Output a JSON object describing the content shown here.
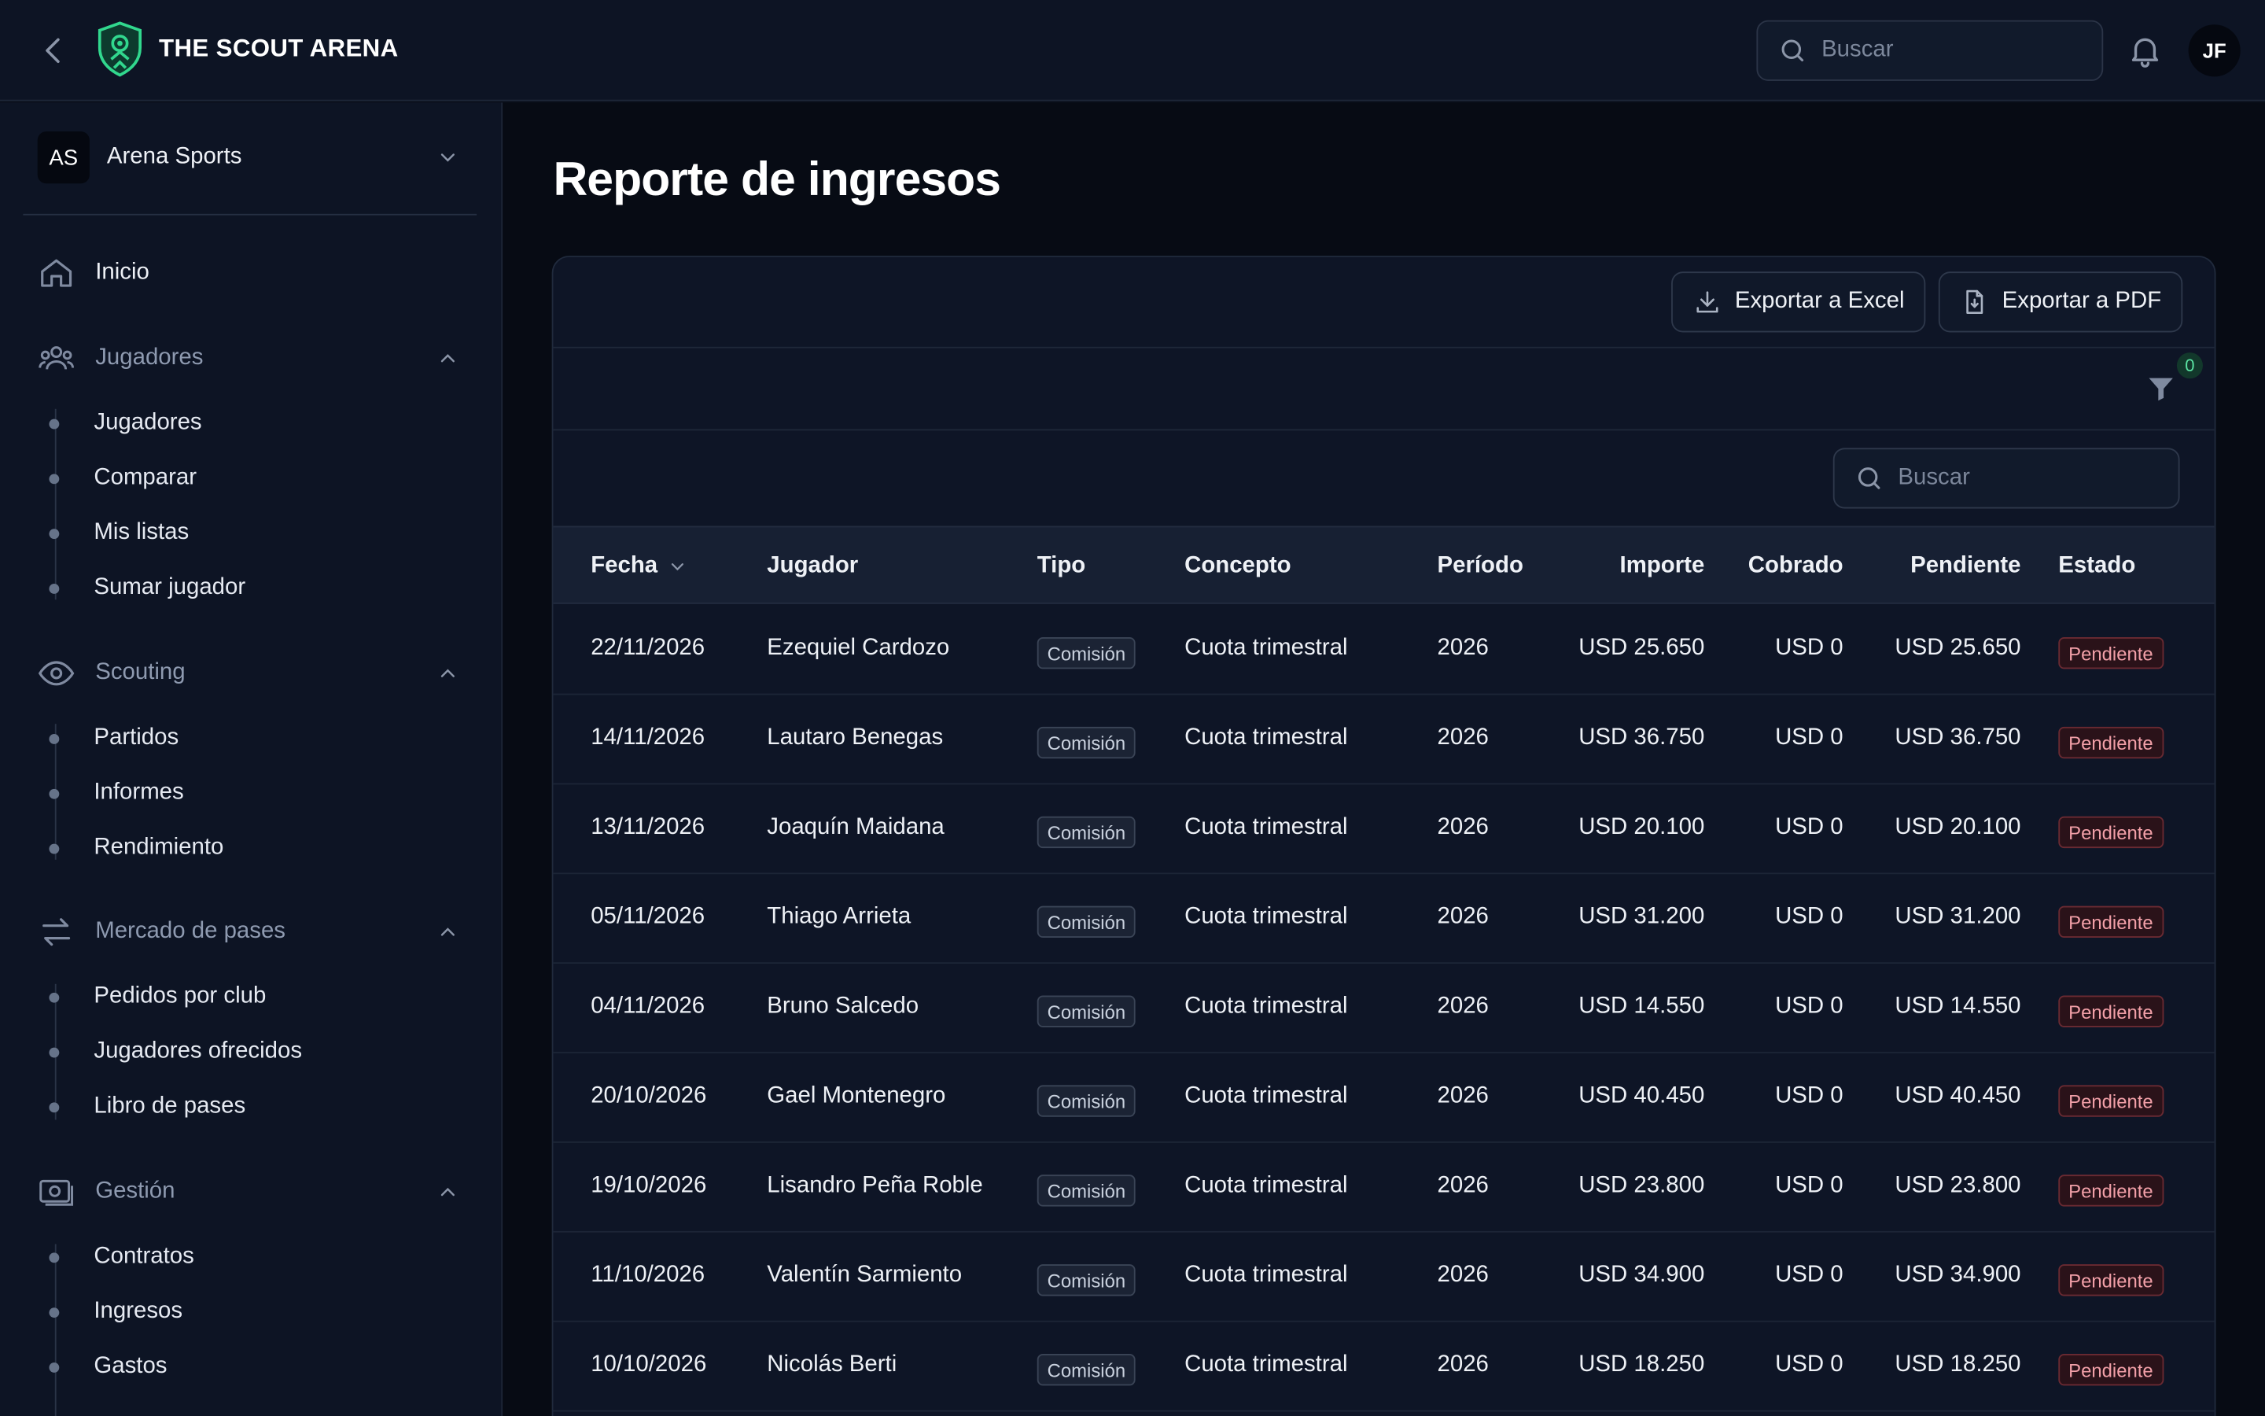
{
  "header": {
    "brand": "THE SCOUT ARENA",
    "search_placeholder": "Buscar",
    "avatar_initials": "JF"
  },
  "sidebar": {
    "org": {
      "initials": "AS",
      "name": "Arena Sports"
    },
    "home": "Inicio",
    "sections": [
      {
        "label": "Jugadores",
        "items": [
          "Jugadores",
          "Comparar",
          "Mis listas",
          "Sumar jugador"
        ]
      },
      {
        "label": "Scouting",
        "items": [
          "Partidos",
          "Informes",
          "Rendimiento"
        ]
      },
      {
        "label": "Mercado de pases",
        "items": [
          "Pedidos por club",
          "Jugadores ofrecidos",
          "Libro de pases"
        ]
      },
      {
        "label": "Gestión",
        "items": [
          "Contratos",
          "Ingresos",
          "Gastos"
        ]
      }
    ]
  },
  "main": {
    "title": "Reporte de ingresos",
    "export_excel": "Exportar a Excel",
    "export_pdf": "Exportar a PDF",
    "filter_count": "0",
    "table_search_placeholder": "Buscar",
    "columns": [
      "Fecha",
      "Jugador",
      "Tipo",
      "Concepto",
      "Período",
      "Importe",
      "Cobrado",
      "Pendiente",
      "Estado"
    ],
    "rows": [
      {
        "fecha": "22/11/2026",
        "jugador": "Ezequiel Cardozo",
        "tipo": "Comisión",
        "concepto": "Cuota trimestral",
        "periodo": "2026",
        "importe": "USD 25.650",
        "cobrado": "USD 0",
        "pendiente": "USD 25.650",
        "estado": "Pendiente"
      },
      {
        "fecha": "14/11/2026",
        "jugador": "Lautaro Benegas",
        "tipo": "Comisión",
        "concepto": "Cuota trimestral",
        "periodo": "2026",
        "importe": "USD 36.750",
        "cobrado": "USD 0",
        "pendiente": "USD 36.750",
        "estado": "Pendiente"
      },
      {
        "fecha": "13/11/2026",
        "jugador": "Joaquín Maidana",
        "tipo": "Comisión",
        "concepto": "Cuota trimestral",
        "periodo": "2026",
        "importe": "USD 20.100",
        "cobrado": "USD 0",
        "pendiente": "USD 20.100",
        "estado": "Pendiente"
      },
      {
        "fecha": "05/11/2026",
        "jugador": "Thiago Arrieta",
        "tipo": "Comisión",
        "concepto": "Cuota trimestral",
        "periodo": "2026",
        "importe": "USD 31.200",
        "cobrado": "USD 0",
        "pendiente": "USD 31.200",
        "estado": "Pendiente"
      },
      {
        "fecha": "04/11/2026",
        "jugador": "Bruno Salcedo",
        "tipo": "Comisión",
        "concepto": "Cuota trimestral",
        "periodo": "2026",
        "importe": "USD 14.550",
        "cobrado": "USD 0",
        "pendiente": "USD 14.550",
        "estado": "Pendiente"
      },
      {
        "fecha": "20/10/2026",
        "jugador": "Gael Montenegro",
        "tipo": "Comisión",
        "concepto": "Cuota trimestral",
        "periodo": "2026",
        "importe": "USD 40.450",
        "cobrado": "USD 0",
        "pendiente": "USD 40.450",
        "estado": "Pendiente"
      },
      {
        "fecha": "19/10/2026",
        "jugador": "Lisandro Peña Roble",
        "tipo": "Comisión",
        "concepto": "Cuota trimestral",
        "periodo": "2026",
        "importe": "USD 23.800",
        "cobrado": "USD 0",
        "pendiente": "USD 23.800",
        "estado": "Pendiente"
      },
      {
        "fecha": "11/10/2026",
        "jugador": "Valentín Sarmiento",
        "tipo": "Comisión",
        "concepto": "Cuota trimestral",
        "periodo": "2026",
        "importe": "USD 34.900",
        "cobrado": "USD 0",
        "pendiente": "USD 34.900",
        "estado": "Pendiente"
      },
      {
        "fecha": "10/10/2026",
        "jugador": "Nicolás Berti",
        "tipo": "Comisión",
        "concepto": "Cuota trimestral",
        "periodo": "2026",
        "importe": "USD 18.250",
        "cobrado": "USD 0",
        "pendiente": "USD 18.250",
        "estado": "Pendiente"
      }
    ]
  }
}
